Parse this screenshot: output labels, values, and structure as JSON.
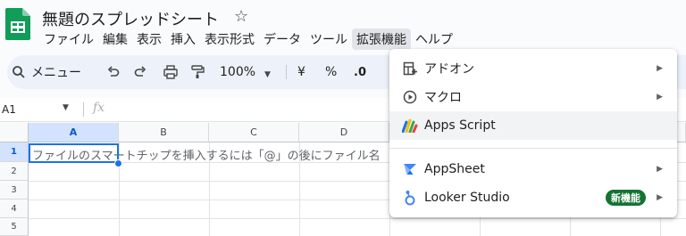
{
  "header": {
    "title": "無題のスプレッドシート",
    "star_icon": "star-icon"
  },
  "menubar": {
    "items": [
      "ファイル",
      "編集",
      "表示",
      "挿入",
      "表示形式",
      "データ",
      "ツール",
      "拡張機能",
      "ヘルプ"
    ],
    "active": "拡張機能"
  },
  "toolbar": {
    "search_label": "メニュー",
    "zoom": "100%",
    "currency": "¥",
    "percent": "%",
    "decimal_decrease": ".0",
    "icons": [
      "undo-icon",
      "redo-icon",
      "print-icon",
      "paint-format-icon",
      "zoom-dropdown-icon"
    ]
  },
  "formula_bar": {
    "cell_ref": "A1",
    "fx": "fx"
  },
  "grid": {
    "columns": [
      "A",
      "B",
      "C",
      "D"
    ],
    "rows": [
      "1",
      "2",
      "3",
      "4",
      "5"
    ],
    "selected_cell": "A1",
    "hint": "ファイルのスマートチップを挿入するには「@」の後にファイル名"
  },
  "extensions_menu": {
    "items": [
      {
        "label": "アドオン",
        "icon": "addon-icon"
      },
      {
        "label": "マクロ",
        "icon": "macro-icon"
      },
      {
        "label": "Apps Script",
        "icon": "apps-script-icon"
      },
      {
        "label": "AppSheet",
        "icon": "appsheet-icon"
      },
      {
        "label": "Looker Studio",
        "icon": "looker-studio-icon",
        "badge": "新機能"
      }
    ]
  },
  "colors": {
    "accent": "#1a73e8",
    "badge": "#137333",
    "sheets_green": "#0f9d58"
  }
}
